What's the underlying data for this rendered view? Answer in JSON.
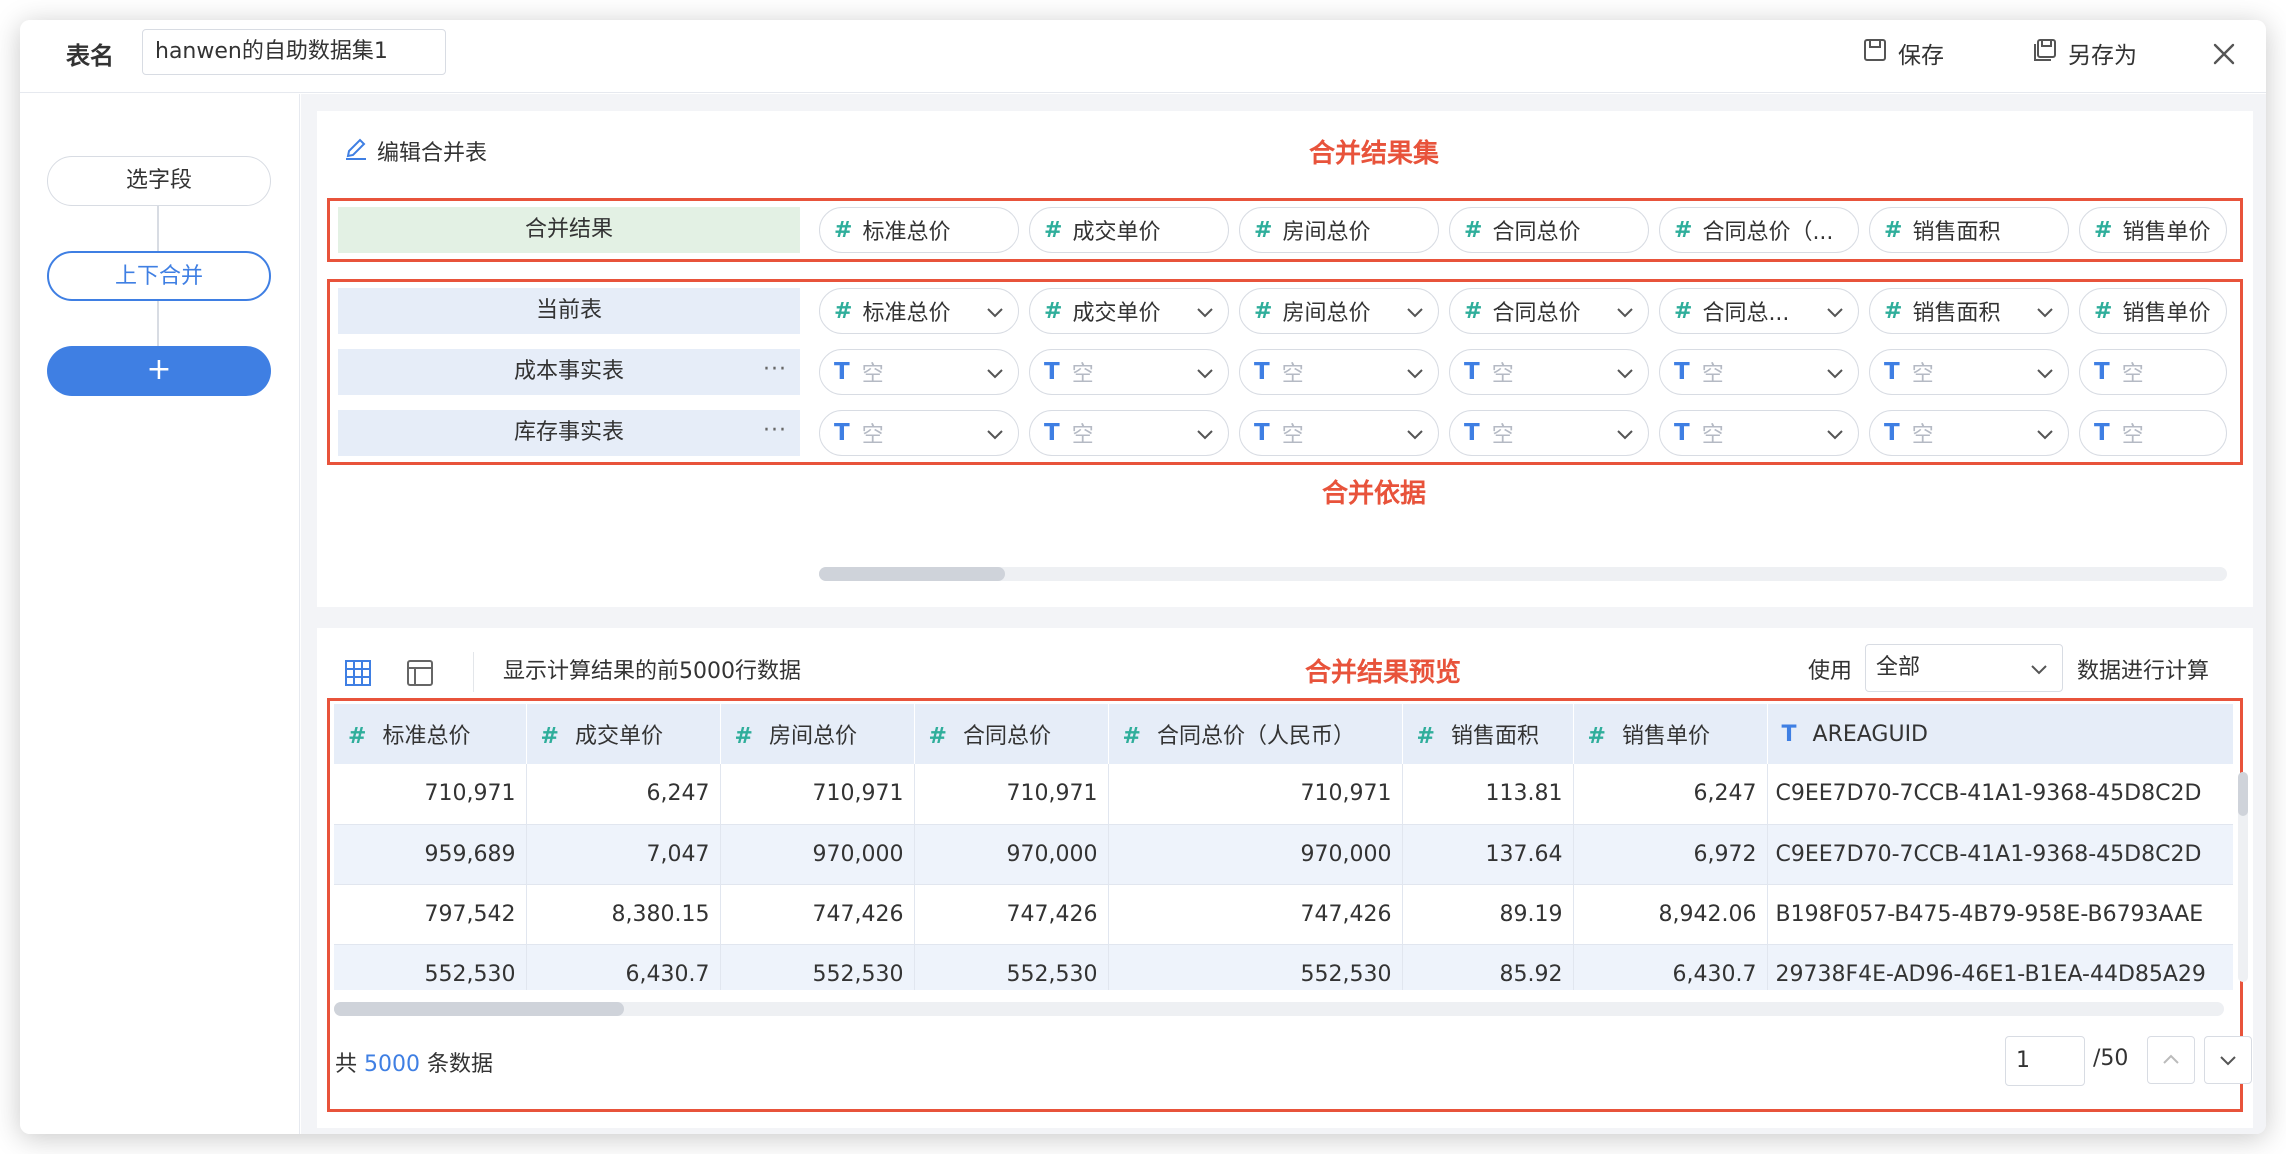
{
  "header": {
    "table_name_label": "表名",
    "table_name_value": "hanwen的自助数据集1",
    "save_label": "保存",
    "save_as_label": "另存为"
  },
  "steps": {
    "select_fields": "选字段",
    "union": "上下合并",
    "add": "+"
  },
  "editor": {
    "edit_label": "编辑合并表",
    "annotation_result": "合并结果集",
    "annotation_basis": "合并依据",
    "result_row_label": "合并结果",
    "result_fields": [
      "标准总价",
      "成交单价",
      "房间总价",
      "合同总价",
      "合同总价（...",
      "销售面积",
      "销售单价"
    ],
    "source_rows": [
      {
        "label": "当前表",
        "fields": [
          "标准总价",
          "成交单价",
          "房间总价",
          "合同总价",
          "合同总...",
          "销售面积",
          "销售单价"
        ]
      },
      {
        "label": "成本事实表",
        "dots": "···",
        "fields": [
          "空",
          "空",
          "空",
          "空",
          "空",
          "空",
          "空"
        ]
      },
      {
        "label": "库存事实表",
        "dots": "···",
        "fields": [
          "空",
          "空",
          "空",
          "空",
          "空",
          "空",
          "空"
        ]
      }
    ]
  },
  "preview": {
    "info_text": "显示计算结果的前5000行数据",
    "annotation": "合并结果预览",
    "use_label": "使用",
    "use_select": "全部",
    "calc_label": "数据进行计算",
    "columns": [
      {
        "type": "#",
        "name": "标准总价"
      },
      {
        "type": "#",
        "name": "成交单价"
      },
      {
        "type": "#",
        "name": "房间总价"
      },
      {
        "type": "#",
        "name": "合同总价"
      },
      {
        "type": "#",
        "name": "合同总价（人民币）"
      },
      {
        "type": "#",
        "name": "销售面积"
      },
      {
        "type": "#",
        "name": "销售单价"
      },
      {
        "type": "T",
        "name": "AREAGUID"
      }
    ],
    "rows": [
      [
        "710,971",
        "6,247",
        "710,971",
        "710,971",
        "710,971",
        "113.81",
        "6,247",
        "C9EE7D70-7CCB-41A1-9368-45D8C2D"
      ],
      [
        "959,689",
        "7,047",
        "970,000",
        "970,000",
        "970,000",
        "137.64",
        "6,972",
        "C9EE7D70-7CCB-41A1-9368-45D8C2D"
      ],
      [
        "797,542",
        "8,380.15",
        "747,426",
        "747,426",
        "747,426",
        "89.19",
        "8,942.06",
        "B198F057-B475-4B79-958E-B6793AAE"
      ],
      [
        "552,530",
        "6,430.7",
        "552,530",
        "552,530",
        "552,530",
        "85.92",
        "6,430.7",
        "29738F4E-AD96-46E1-B1EA-44D85A29"
      ]
    ],
    "footer_prefix": "共",
    "footer_count": "5000",
    "footer_suffix": "条数据",
    "page_value": "1",
    "page_total": "/50"
  },
  "colors": {
    "accent": "#3f7fe3",
    "annotation": "#e8533b",
    "number_type": "#2fae9b"
  }
}
